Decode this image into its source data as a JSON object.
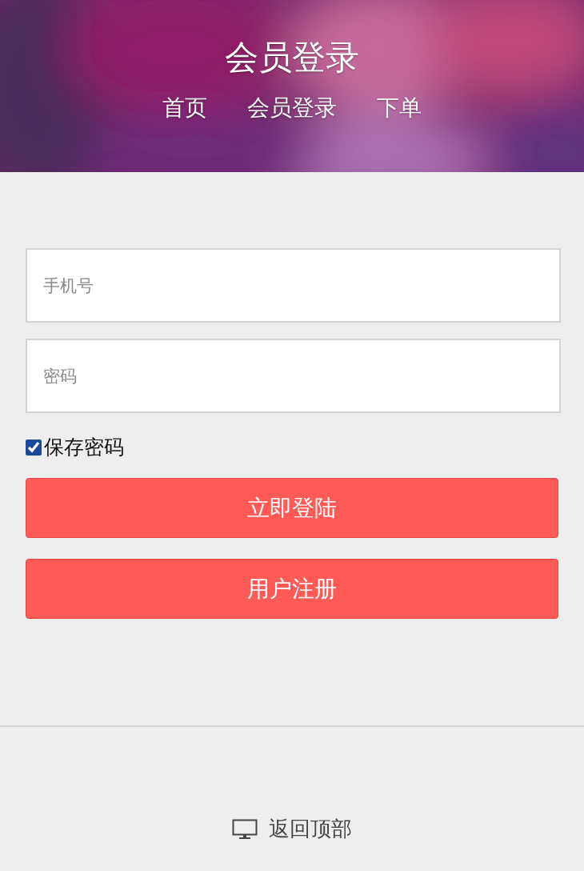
{
  "header": {
    "title": "会员登录",
    "nav": [
      "首页",
      "会员登录",
      "下单"
    ]
  },
  "form": {
    "phone": {
      "placeholder": "手机号"
    },
    "password": {
      "placeholder": "密码"
    },
    "remember": {
      "label": "保存密码",
      "checked": true
    },
    "buttons": [
      "立即登陆",
      "用户注册"
    ]
  },
  "footer": {
    "back_to_top": "返回顶部"
  }
}
